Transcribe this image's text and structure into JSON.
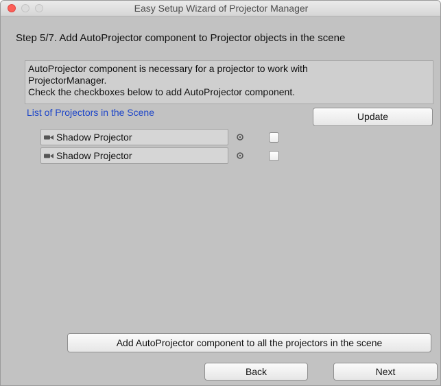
{
  "window": {
    "title": "Easy Setup Wizard of Projector Manager"
  },
  "step": {
    "title": "Step 5/7. Add AutoProjector component to Projector objects in the scene"
  },
  "help": {
    "lines": [
      "AutoProjector component is necessary for a projector to work with",
      "ProjectorManager.",
      "Check the checkboxes below to add AutoProjector component."
    ]
  },
  "projectors": {
    "header": "List of Projectors in the Scene",
    "update_label": "Update",
    "items": [
      {
        "name": "Shadow Projector",
        "checked": false
      },
      {
        "name": "Shadow Projector",
        "checked": false
      }
    ]
  },
  "actions": {
    "add_all_label": "Add AutoProjector component to all the projectors in the scene",
    "back_label": "Back",
    "next_label": "Next"
  },
  "colors": {
    "background": "#c2c2c2",
    "link_blue": "#1d45c8",
    "close_red": "#fc5f57"
  },
  "icons": {
    "object_field": "projector-icon",
    "picker": "object-picker-icon"
  }
}
